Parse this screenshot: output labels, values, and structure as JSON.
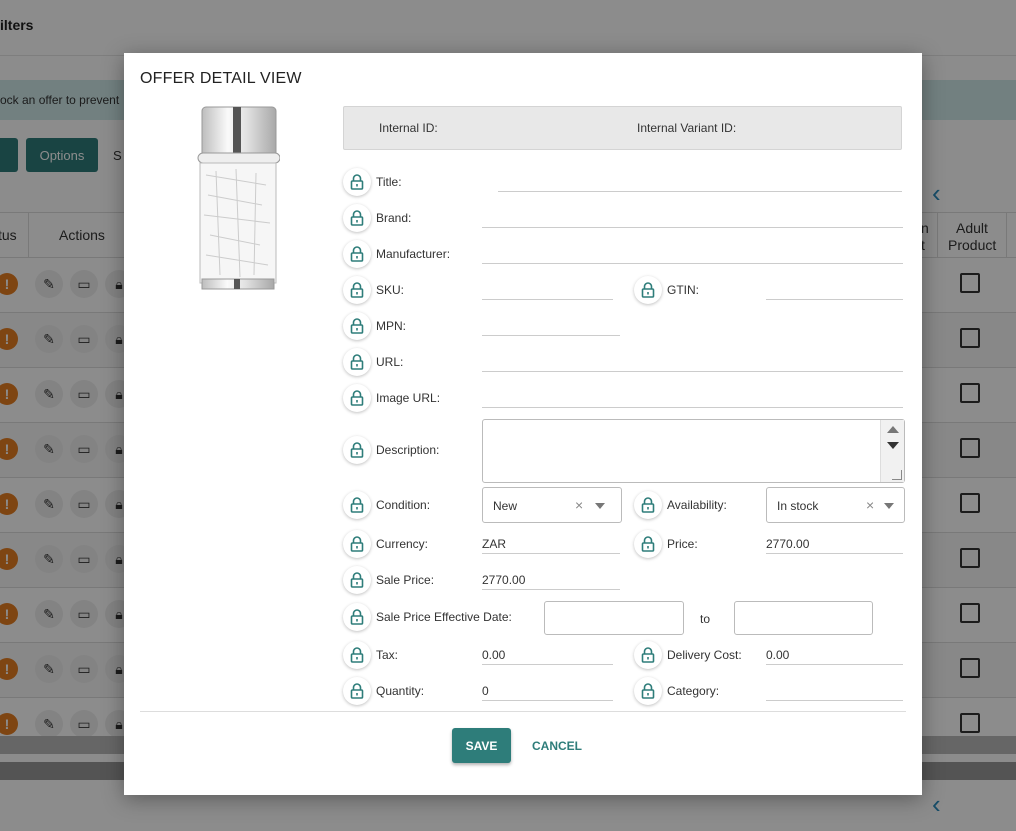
{
  "background": {
    "header_title": "ilters",
    "banner_text": "ock an offer to prevent",
    "options_button": "Options",
    "s_text": "S",
    "columns": {
      "status": "tus",
      "actions": "Actions",
      "n": "n",
      "t": "t",
      "adult": "Adult",
      "product": "Product"
    },
    "row_count": 9
  },
  "modal": {
    "title": "OFFER DETAIL VIEW",
    "internal_id_label": "Internal ID:",
    "internal_variant_id_label": "Internal Variant ID:",
    "fields": {
      "title": {
        "label": "Title:",
        "value": ""
      },
      "brand": {
        "label": "Brand:",
        "value": ""
      },
      "manufacturer": {
        "label": "Manufacturer:",
        "value": ""
      },
      "sku": {
        "label": "SKU:",
        "value": ""
      },
      "gtin": {
        "label": "GTIN:",
        "value": ""
      },
      "mpn": {
        "label": "MPN:",
        "value": ""
      },
      "url": {
        "label": "URL:",
        "value": ""
      },
      "image_url": {
        "label": "Image URL:",
        "value": ""
      },
      "description": {
        "label": "Description:",
        "value": ""
      },
      "condition": {
        "label": "Condition:",
        "value": "New"
      },
      "availability": {
        "label": "Availability:",
        "value": "In stock"
      },
      "currency": {
        "label": "Currency:",
        "value": "ZAR"
      },
      "price": {
        "label": "Price:",
        "value": "2770.00"
      },
      "sale_price": {
        "label": "Sale Price:",
        "value": "2770.00"
      },
      "sale_price_effective_date": {
        "label": "Sale Price Effective Date:",
        "to": "to"
      },
      "tax": {
        "label": "Tax:",
        "value": "0.00"
      },
      "delivery_cost": {
        "label": "Delivery Cost:",
        "value": "0.00"
      },
      "quantity": {
        "label": "Quantity:",
        "value": "0"
      },
      "category": {
        "label": "Category:",
        "value": ""
      }
    },
    "clear_glyph": "×",
    "save_label": "SAVE",
    "cancel_label": "CANCEL"
  },
  "colors": {
    "accent": "#2e7d7a",
    "warning": "#e67e22",
    "overlay": "rgba(0,0,0,0.45)"
  },
  "icons": {
    "lock": "lock-icon",
    "pencil": "pencil-icon",
    "laptop": "laptop-icon",
    "warning": "warning-icon",
    "chevron": "chevron-left-icon"
  }
}
